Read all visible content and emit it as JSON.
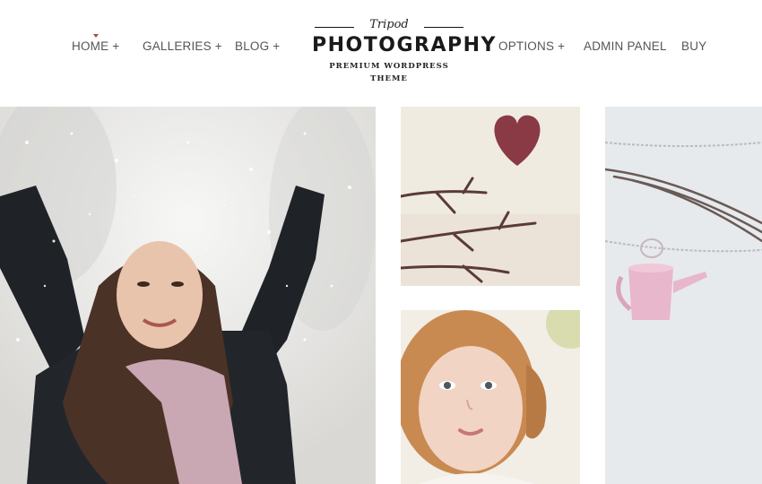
{
  "nav": {
    "home": "HOME +",
    "galleries": "GALLERIES +",
    "blog": "BLOG +",
    "options": "OPTIONS +",
    "admin_panel": "ADMIN PANEL",
    "buy": "BUY"
  },
  "logo": {
    "script": "Tripod",
    "title": "PHOTOGRAPHY",
    "tagline": "PREMIUM WORDPRESS THEME"
  },
  "colors": {
    "accent": "#b0443a",
    "nav_text": "#555555",
    "logo_text": "#1a1a1a"
  }
}
